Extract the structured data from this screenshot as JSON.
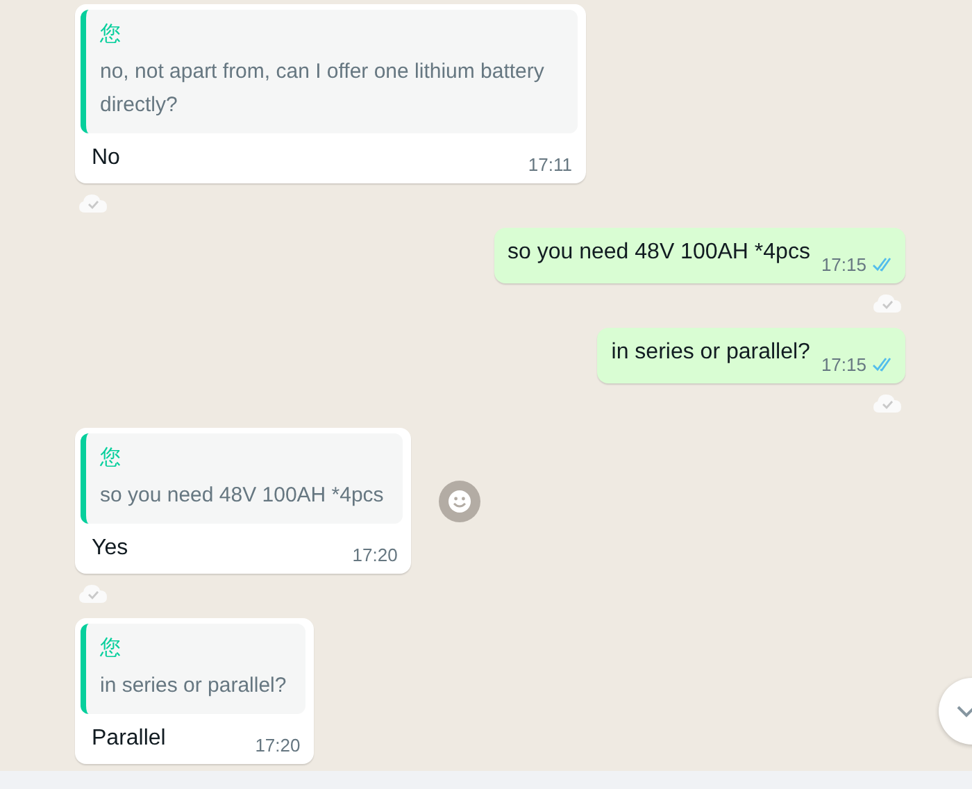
{
  "messages": [
    {
      "kind": "incoming",
      "quote": {
        "author": "您",
        "text": "no, not apart from, can I offer one lithium battery directly?"
      },
      "text": "No",
      "time": "17:11",
      "reaction_marker": true,
      "emoji_button": false
    },
    {
      "kind": "outgoing",
      "text": "so you need 48V 100AH *4pcs",
      "time": "17:15",
      "read": true,
      "reaction_marker": true,
      "emoji_button": false
    },
    {
      "kind": "outgoing",
      "text": "in series or parallel?",
      "time": "17:15",
      "read": true,
      "reaction_marker": true,
      "emoji_button": false
    },
    {
      "kind": "incoming",
      "quote": {
        "author": "您",
        "text": "so you need 48V 100AH *4pcs"
      },
      "text": "Yes",
      "time": "17:20",
      "reaction_marker": true,
      "emoji_button": true
    },
    {
      "kind": "incoming",
      "quote": {
        "author": "您",
        "text": "in series or parallel?"
      },
      "text": "Parallel",
      "time": "17:20",
      "emoji_button": false
    }
  ],
  "scroll_down_button": true
}
